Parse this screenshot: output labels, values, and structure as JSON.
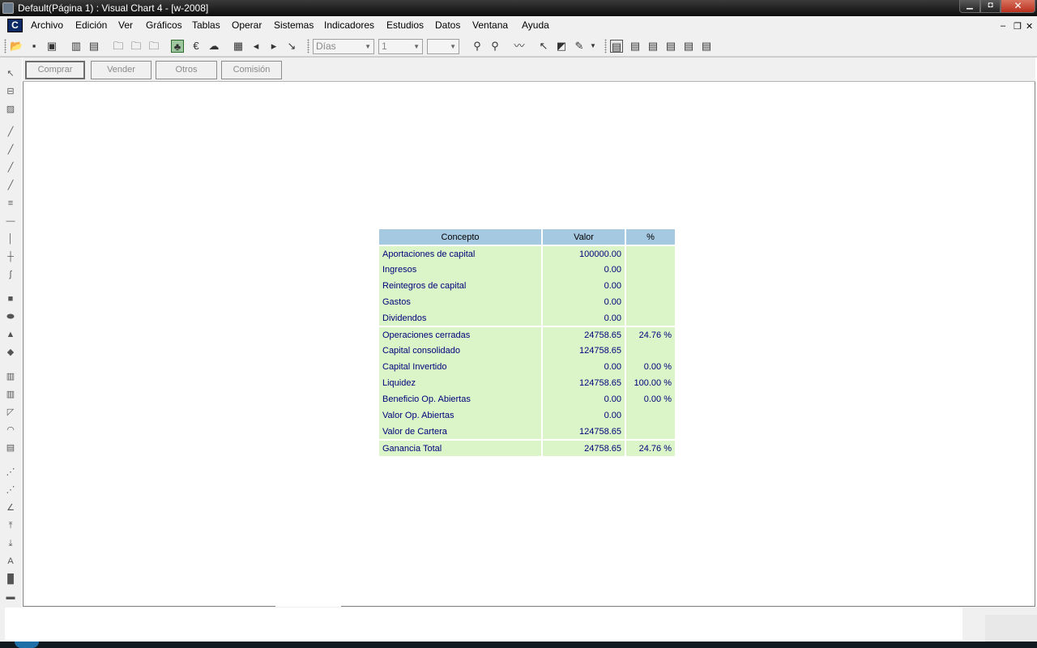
{
  "window": {
    "title": "Default(Página 1) : Visual Chart 4 - [w-2008]"
  },
  "menu": {
    "items": [
      "Archivo",
      "Edición",
      "Ver",
      "Gráficos",
      "Tablas",
      "Operar",
      "Sistemas",
      "Indicadores",
      "Estudios",
      "Datos",
      "Ventana",
      "Ayuda"
    ]
  },
  "toolbar": {
    "period_combo": "Días",
    "multiplier_combo": "1",
    "third_combo": ""
  },
  "buttons": {
    "comprar": "Comprar",
    "vender": "Vender",
    "otros": "Otros",
    "comision": "Comisión"
  },
  "table": {
    "headers": [
      "Concepto",
      "Valor",
      "%"
    ],
    "rows": [
      [
        "Aportaciones de capital",
        "100000.00",
        ""
      ],
      [
        "Ingresos",
        "0.00",
        ""
      ],
      [
        "Reintegros de capital",
        "0.00",
        ""
      ],
      [
        "Gastos",
        "0.00",
        ""
      ],
      [
        "Dividendos",
        "0.00",
        ""
      ],
      [
        "Operaciones cerradas",
        "24758.65",
        "24.76 %"
      ],
      [
        "Capital consolidado",
        "124758.65",
        ""
      ],
      [
        "Capital Invertido",
        "0.00",
        "0.00 %"
      ],
      [
        "Liquidez",
        "124758.65",
        "100.00 %"
      ],
      [
        "Beneficio Op. Abiertas",
        "0.00",
        "0.00 %"
      ],
      [
        "Valor Op. Abiertas",
        "0.00",
        ""
      ],
      [
        "Valor de Cartera",
        "124758.65",
        ""
      ],
      [
        "Ganancia Total",
        "24758.65",
        "24.76 %"
      ]
    ]
  },
  "colors": {
    "header_bg": "#a6c9e2",
    "row_bg": "#dbf5c8",
    "row_text": "#00007a"
  }
}
